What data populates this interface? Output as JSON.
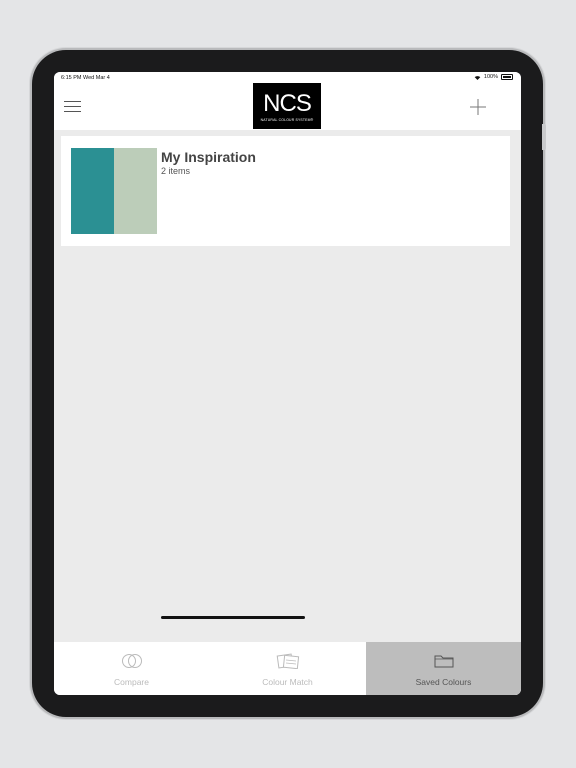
{
  "status_bar": {
    "time": "6:15 PM   Wed Mar 4",
    "battery": "100%"
  },
  "header": {
    "logo_text": "NCS",
    "logo_subtitle": "NATURAL COLOUR SYSTEM®"
  },
  "collections": [
    {
      "title": "My Inspiration",
      "count": "2 items",
      "swatches": [
        "#2b9093",
        "#bccdb9"
      ]
    }
  ],
  "tabs": [
    {
      "label": "Compare",
      "icon": "compare-icon",
      "active": false
    },
    {
      "label": "Colour Match",
      "icon": "colour-match-icon",
      "active": false
    },
    {
      "label": "Saved Colours",
      "icon": "folder-icon",
      "active": true
    }
  ],
  "colors": {
    "accent_swatch_1": "#2b9093",
    "accent_swatch_2": "#bccdb9",
    "active_tab": "#bdbdbd"
  }
}
